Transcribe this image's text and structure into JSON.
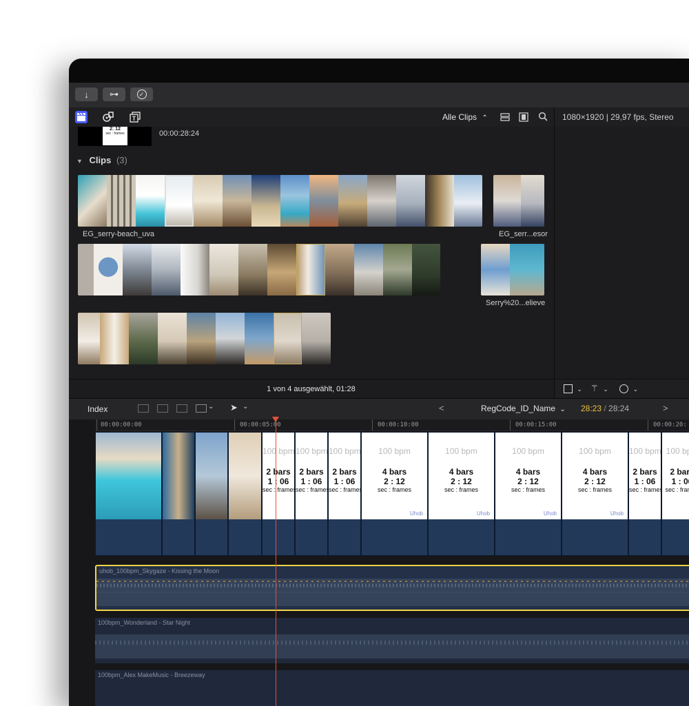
{
  "toolbar": {
    "import_icon": "↓",
    "key_icon": "⊶",
    "check_icon": "✓"
  },
  "browser": {
    "filter_label": "Alle Clips",
    "filter_chevron": "⌃",
    "top_clip_time": "00:00:28:24",
    "top_clip_thumb_line1": "2: 12",
    "top_clip_thumb_line2": "sec : frames",
    "clips_heading": "Clips",
    "clips_count": "(3)",
    "clip1_name": "EG_serry-beach_uva",
    "clip2_name": "EG_serr...esor",
    "clip3_name": "Serry%20...elieve",
    "status": "1 von 4 ausgewählt, 01:28"
  },
  "inspector": {
    "format_info": "1080×1920 | 29,97 fps, Stereo"
  },
  "timeline_bar": {
    "index_label": "Index",
    "nav_prev": "<",
    "nav_next": ">",
    "project_name": "RegCode_ID_Name",
    "timecode_current": "28:23",
    "timecode_sep": " / ",
    "timecode_total": "28:24"
  },
  "ruler": [
    "00:00:00:00",
    "00:00:05:00",
    "00:00:10:00",
    "00:00:15:00",
    "00:00:20:"
  ],
  "marker_clip": {
    "bpm": "100 bpm",
    "bars4": "4 bars",
    "bars2": "2 bars",
    "ratio4": "2 : 12",
    "ratio2": "1 : 06",
    "secf": "sec : frames",
    "brand": "Uhob"
  },
  "audio_tracks": [
    "uhob_100bpm_Skygaze - Kissing the Moon",
    "100bpm_Wonderland - Star Night",
    "100bpm_Alex MakeMusic - Breezeway"
  ],
  "colors": {
    "accent_yellow": "#f5d547",
    "playhead": "#e0523a",
    "video_clip": "#23395a",
    "audio_clip": "#243048"
  }
}
